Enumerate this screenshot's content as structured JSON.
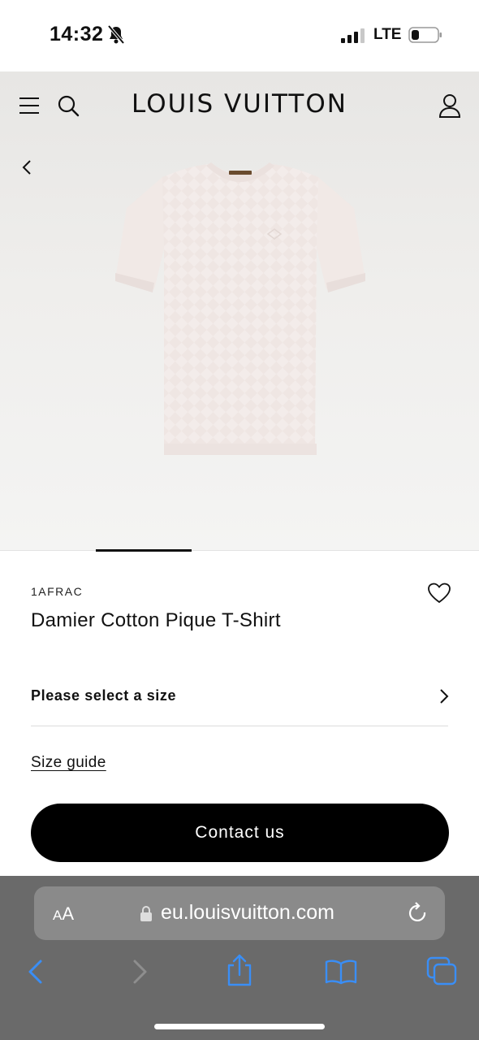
{
  "status_bar": {
    "time": "14:32",
    "network": "LTE",
    "icons": [
      "bell-slash-icon",
      "signal-icon",
      "battery-icon"
    ]
  },
  "header": {
    "brand": "LOUIS VUITTON",
    "icons": [
      "menu-icon",
      "search-icon",
      "account-icon"
    ]
  },
  "product": {
    "sku": "1AFRAC",
    "title": "Damier Cotton Pique T-Shirt",
    "image_icon": "tshirt-image",
    "carousel_active_index": 1
  },
  "size_selector": {
    "label": "Please select a size"
  },
  "size_guide": {
    "label": "Size guide"
  },
  "contact_button": {
    "label": "Contact us"
  },
  "safari": {
    "text_size_big": "A",
    "text_size_small": "A",
    "url": "eu.louisvuitton.com",
    "toolbar_icons": [
      "back-icon",
      "forward-icon",
      "share-icon",
      "bookmarks-icon",
      "tabs-icon"
    ],
    "accent_color": "#3a8ef6"
  },
  "colors": {
    "button_bg": "#000000",
    "safari_bar": "#6a6a6a"
  }
}
